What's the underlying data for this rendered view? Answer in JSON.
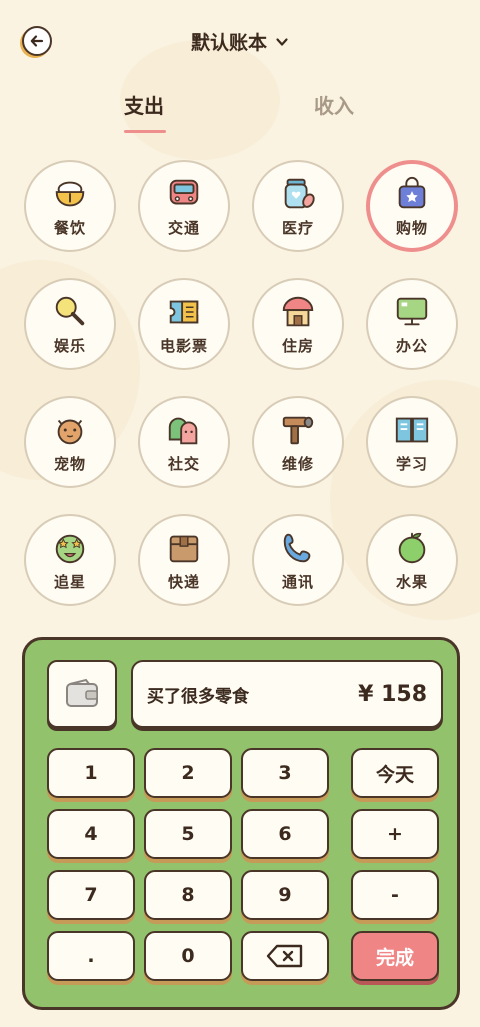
{
  "header": {
    "book_title": "默认账本",
    "back_icon": "arrow-left-icon",
    "dropdown_icon": "chevron-down-icon"
  },
  "tabs": {
    "expense": "支出",
    "income": "收入"
  },
  "categories": [
    {
      "label": "餐饮",
      "icon": "rice-bowl-icon",
      "selected": false
    },
    {
      "label": "交通",
      "icon": "bus-icon",
      "selected": false
    },
    {
      "label": "医疗",
      "icon": "medicine-jar-icon",
      "selected": false
    },
    {
      "label": "购物",
      "icon": "shopping-bag-icon",
      "selected": true
    },
    {
      "label": "娱乐",
      "icon": "lollipop-icon",
      "selected": false
    },
    {
      "label": "电影票",
      "icon": "ticket-icon",
      "selected": false
    },
    {
      "label": "住房",
      "icon": "house-icon",
      "selected": false
    },
    {
      "label": "办公",
      "icon": "monitor-icon",
      "selected": false
    },
    {
      "label": "宠物",
      "icon": "cat-icon",
      "selected": false
    },
    {
      "label": "社交",
      "icon": "friends-icon",
      "selected": false
    },
    {
      "label": "维修",
      "icon": "hammer-icon",
      "selected": false
    },
    {
      "label": "学习",
      "icon": "book-icon",
      "selected": false
    },
    {
      "label": "追星",
      "icon": "star-eyes-icon",
      "selected": false
    },
    {
      "label": "快递",
      "icon": "package-icon",
      "selected": false
    },
    {
      "label": "通讯",
      "icon": "phone-icon",
      "selected": false
    },
    {
      "label": "水果",
      "icon": "apple-icon",
      "selected": false
    }
  ],
  "keypad": {
    "wallet_icon": "wallet-icon",
    "memo": "买了很多零食",
    "amount": "¥ 158",
    "keys": {
      "k1": "1",
      "k2": "2",
      "k3": "3",
      "today": "今天",
      "k4": "4",
      "k5": "5",
      "k6": "6",
      "plus": "+",
      "k7": "7",
      "k8": "8",
      "k9": "9",
      "minus": "-",
      "dot": ".",
      "k0": "0",
      "done": "完成"
    },
    "backspace_icon": "backspace-icon"
  },
  "colors": {
    "background": "#fbf3e2",
    "accent_pink": "#ef8f8d",
    "panel_green": "#93c26c",
    "outline": "#4a3628"
  }
}
